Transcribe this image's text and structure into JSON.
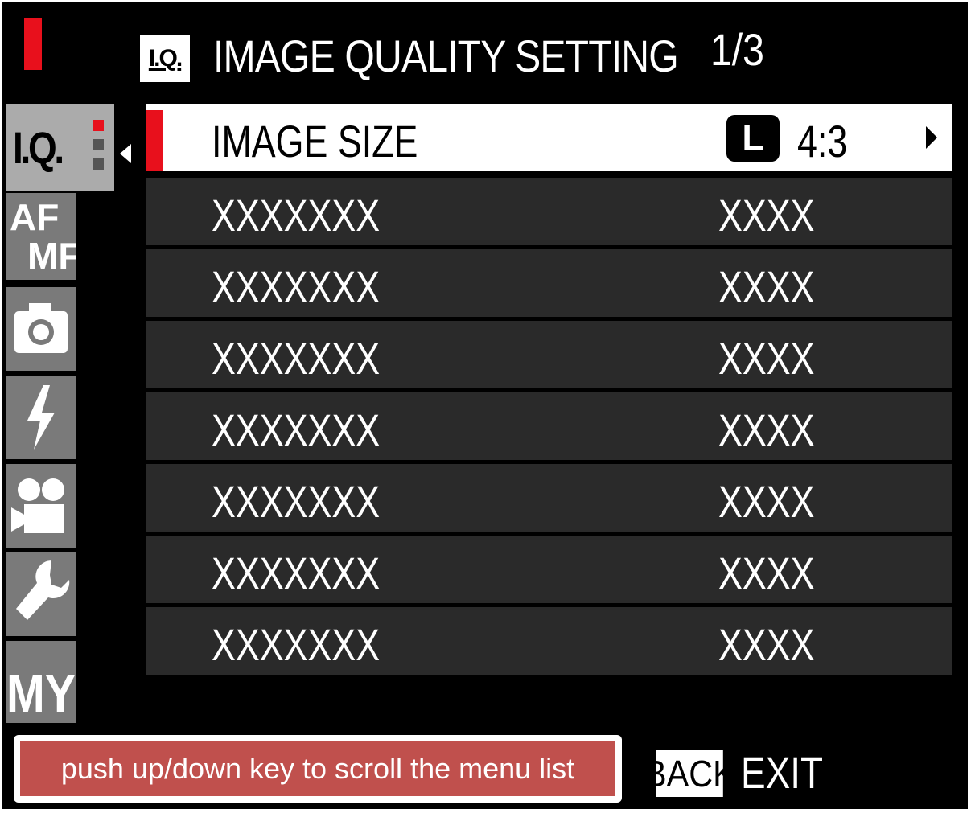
{
  "header": {
    "badge": "I.Q.",
    "title": "IMAGE QUALITY SETTING",
    "page_indicator": "1/3"
  },
  "sidebar": {
    "tabs": [
      {
        "label": "I.Q.",
        "icon": "image-quality-icon",
        "active": true
      },
      {
        "label": "AF MF",
        "icon": "af-mf-icon"
      },
      {
        "label": "",
        "icon": "camera-icon"
      },
      {
        "label": "",
        "icon": "flash-icon"
      },
      {
        "label": "",
        "icon": "movie-camera-icon"
      },
      {
        "label": "",
        "icon": "wrench-icon"
      },
      {
        "label": "MY",
        "icon": "my-menu-icon"
      }
    ]
  },
  "menu": {
    "items": [
      {
        "label": "IMAGE SIZE",
        "size_badge": "L",
        "value": "4:3",
        "selected": true
      },
      {
        "label": "XXXXXXX",
        "value": "XXXX"
      },
      {
        "label": "XXXXXXX",
        "value": "XXXX"
      },
      {
        "label": "XXXXXXX",
        "value": "XXXX"
      },
      {
        "label": "XXXXXXX",
        "value": "XXXX"
      },
      {
        "label": "XXXXXXX",
        "value": "XXXX"
      },
      {
        "label": "XXXXXXX",
        "value": "XXXX"
      },
      {
        "label": "XXXXXXX",
        "value": "XXXX"
      }
    ]
  },
  "footer": {
    "hint": "push up/down key to scroll the menu list",
    "back_label": "BACK",
    "exit_label": "EXIT"
  },
  "colors": {
    "accent_red": "#e8101c",
    "hint_background": "#c0504d",
    "row_background": "#2a2a2a",
    "active_tab": "#ababab",
    "inactive_tab": "#7a7a7a"
  }
}
